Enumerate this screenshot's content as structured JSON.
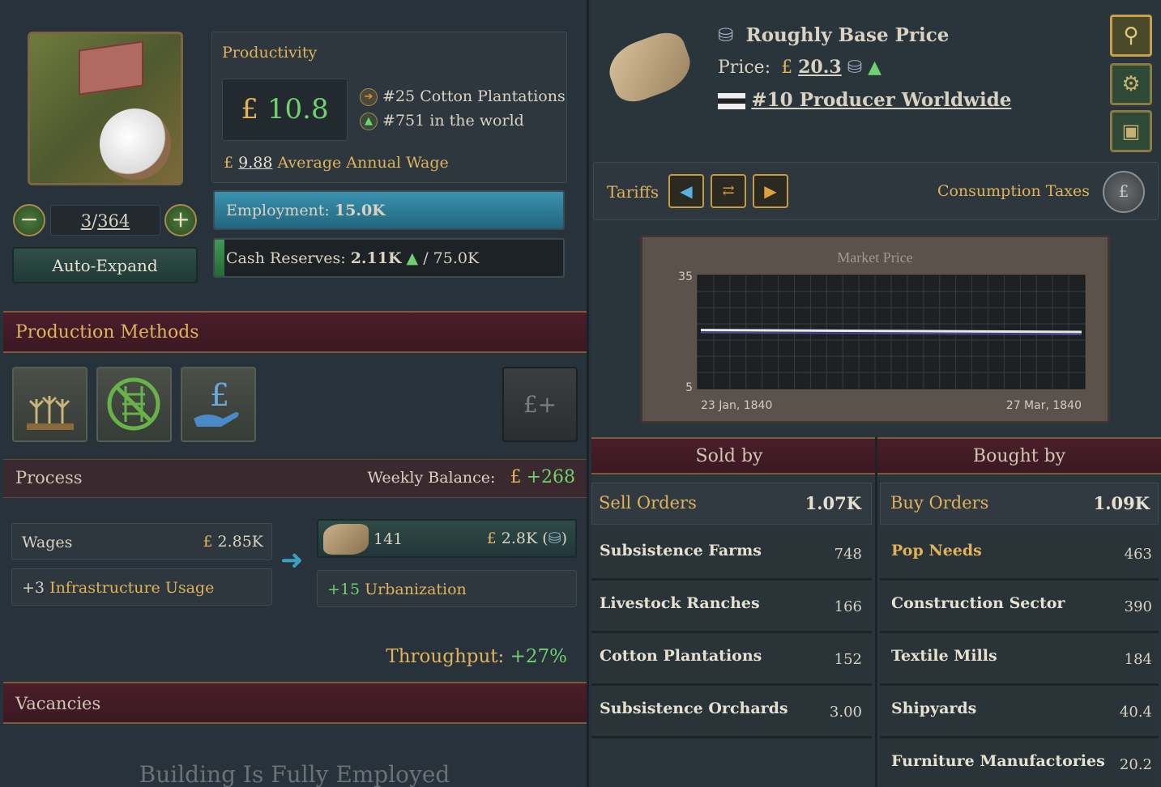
{
  "building": {
    "level_current": "3",
    "level_max": "364",
    "auto_expand_label": "Auto-Expand"
  },
  "productivity": {
    "title": "Productivity",
    "currency": "£",
    "value": "10.8",
    "rank_good_prefix": "#25",
    "rank_good_label": "Cotton Plantations",
    "rank_world_prefix": "#751",
    "rank_world_label": "in the world",
    "wage_value": "9.88",
    "wage_label": "Average Annual Wage"
  },
  "employment": {
    "label": "Employment:",
    "value": "15.0K",
    "fill": 1.0
  },
  "cash": {
    "label": "Cash Reserves:",
    "value": "2.11K",
    "max": "/ 75.0K",
    "fill": 0.028
  },
  "production_methods": {
    "title": "Production Methods",
    "icons": [
      "wheat-icon",
      "no-railway-icon",
      "payment-hand-icon"
    ],
    "extra_icon": "pound-plus-icon",
    "extra_label": "£+"
  },
  "process": {
    "title": "Process",
    "balance_label": "Weekly Balance:",
    "balance_value": "+268",
    "wages_label": "Wages",
    "wages_value": "2.85K",
    "infra_value": "+3",
    "infra_label": "Infrastructure Usage",
    "output_qty": "141",
    "output_value": "2.8K",
    "urban_value": "+15",
    "urban_label": "Urbanization",
    "throughput_label": "Throughput:",
    "throughput_value": "+27%"
  },
  "vacancies": {
    "title": "Vacancies",
    "message": "Building Is Fully Employed"
  },
  "goods": {
    "base_price_label": "Roughly Base Price",
    "price_label": "Price:",
    "price_value": "20.3",
    "producer_rank": "#10 Producer Worldwide",
    "tariffs_label": "Tariffs",
    "consumption_label": "Consumption Taxes"
  },
  "chart_data": {
    "type": "line",
    "title": "Market Price",
    "x": [
      "23 Jan, 1840",
      "27 Mar, 1840"
    ],
    "series": [
      {
        "values": [
          20.5,
          20.0
        ]
      }
    ],
    "ylim": [
      5,
      35
    ],
    "yticks": [
      "35",
      "5"
    ],
    "grid": true
  },
  "market": {
    "sold_by": "Sold by",
    "bought_by": "Bought by",
    "sell_orders_label": "Sell Orders",
    "sell_orders_value": "1.07K",
    "buy_orders_label": "Buy Orders",
    "buy_orders_value": "1.09K",
    "sellers": [
      {
        "name": "Subsistence Farms",
        "value": "748"
      },
      {
        "name": "Livestock Ranches",
        "value": "166"
      },
      {
        "name": "Cotton Plantations",
        "value": "152"
      },
      {
        "name": "Subsistence Orchards",
        "value": "3.00"
      }
    ],
    "buyers": [
      {
        "name": "Pop Needs",
        "value": "463"
      },
      {
        "name": "Construction Sector",
        "value": "390"
      },
      {
        "name": "Textile Mills",
        "value": "184"
      },
      {
        "name": "Shipyards",
        "value": "40.4"
      },
      {
        "name": "Furniture Manufactories",
        "value": "20.2"
      }
    ]
  },
  "colors": {
    "gold": "#e0b25c",
    "green": "#6fd26f",
    "teal_bar": "#2f8aa6",
    "banner": "#4a1e2a"
  }
}
